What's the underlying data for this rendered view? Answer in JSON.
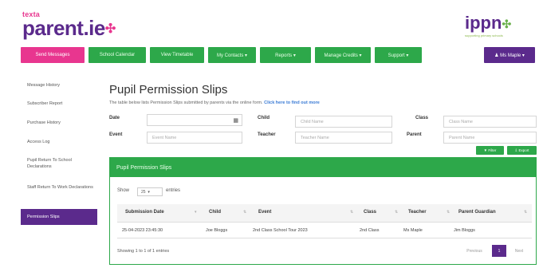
{
  "brand": {
    "logo_small": "texta",
    "logo_main": "parent.ie",
    "partner_logo": "ippn",
    "partner_tagline": "supporting primary schools"
  },
  "nav": [
    {
      "label": "Send Messages",
      "active": true
    },
    {
      "label": "School Calendar"
    },
    {
      "label": "View Timetable"
    },
    {
      "label": "My Contacts ▾"
    },
    {
      "label": "Reports ▾"
    },
    {
      "label": "Manage Credits ▾"
    },
    {
      "label": "Support ▾"
    }
  ],
  "user_menu": "♟ Ms Maple ▾",
  "sidebar": [
    "Message History",
    "Subscriber Report",
    "Purchase History",
    "Access Log",
    "Pupil Return To School Declarations",
    "Staff Return To Work Declarations",
    "Permission Slips"
  ],
  "page": {
    "title": "Pupil Permission Slips",
    "description": "The table below lists Permission Slips submitted by parents via the online form.",
    "description_link": "Click here to find out more"
  },
  "filters": {
    "date_label": "Date",
    "child_label": "Child",
    "class_label": "Class",
    "event_label": "Event",
    "teacher_label": "Teacher",
    "parent_label": "Parent",
    "child_placeholder": "Child Name",
    "class_placeholder": "Class Name",
    "event_placeholder": "Event Name",
    "teacher_placeholder": "Teacher Name",
    "parent_placeholder": "Parent Name",
    "filter_button": "▼ Filter",
    "export_button": "⇩ Export"
  },
  "panel": {
    "title": "Pupil Permission Slips",
    "show_label": "Show",
    "show_value": "25",
    "entries_label": "entries",
    "columns": [
      "Submission Date",
      "Child",
      "Event",
      "Class",
      "Teacher",
      "Parent Guardian"
    ],
    "rows": [
      [
        "25-04-2023 23:45:30",
        "Joe Bloggs",
        "2nd Class School Tour 2023",
        "2nd Class",
        "Ms Maple",
        "Jim Bloggs"
      ]
    ],
    "info": "Showing 1 to 1 of 1 entries",
    "pagination": {
      "previous": "Previous",
      "current": "1",
      "next": "Next"
    }
  },
  "colors": {
    "brand_purple": "#5b2a8c",
    "brand_pink": "#e8368f",
    "accent_green": "#2da84a"
  }
}
